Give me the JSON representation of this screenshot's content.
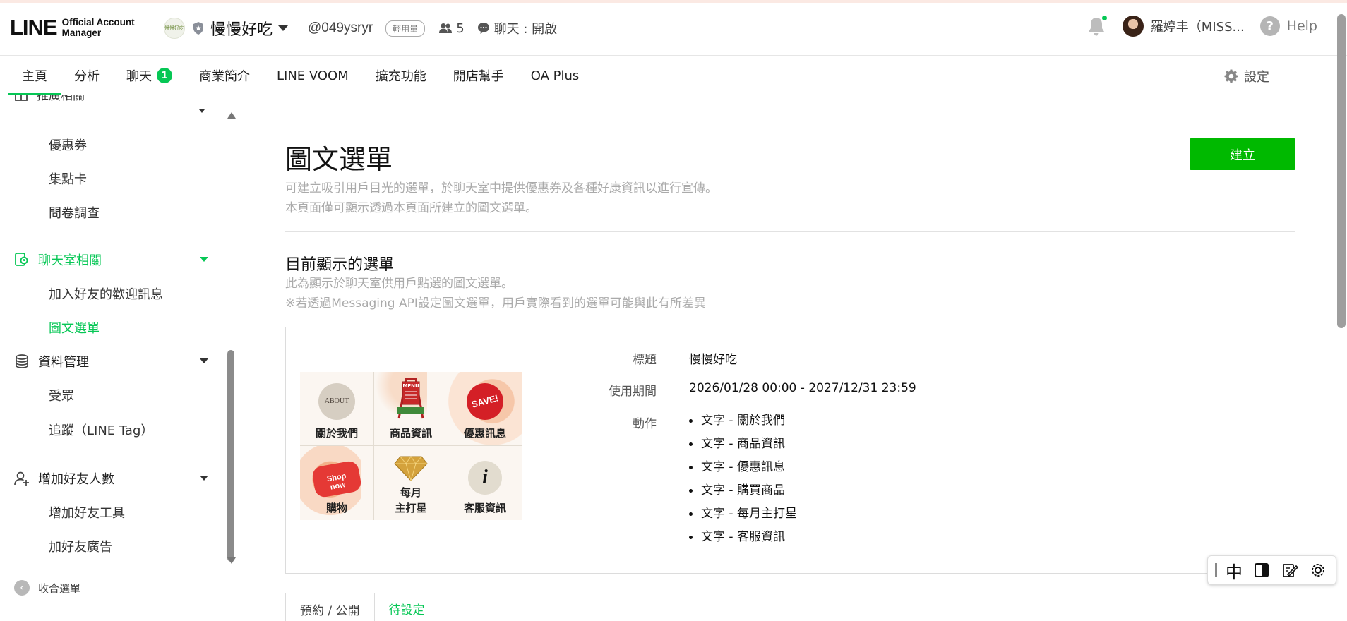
{
  "header": {
    "logo_main": "LINE",
    "logo_sub_line1": "Official Account",
    "logo_sub_line2": "Manager",
    "account_thumb": "慢慢好吃",
    "account_name": "慢慢好吃",
    "account_id": "@049ysryr",
    "plan_badge": "輕用量",
    "friend_count": "5",
    "chat_status": "聊天 : 開啟",
    "user_name": "羅婷丰（MISS...",
    "help_label": "Help"
  },
  "nav": {
    "tabs": [
      {
        "label": "主頁"
      },
      {
        "label": "分析"
      },
      {
        "label": "聊天",
        "badge": "1"
      },
      {
        "label": "商業簡介"
      },
      {
        "label": "LINE VOOM"
      },
      {
        "label": "擴充功能"
      },
      {
        "label": "開店幫手"
      },
      {
        "label": "OA Plus"
      }
    ],
    "settings_label": "設定"
  },
  "sidebar": {
    "cut_group": "推廣相關",
    "promo_items": [
      "優惠券",
      "集點卡",
      "問卷調查"
    ],
    "chat_group": "聊天室相關",
    "chat_items": [
      "加入好友的歡迎訊息",
      "圖文選單"
    ],
    "data_group": "資料管理",
    "data_items": [
      "受眾",
      "追蹤（LINE Tag）"
    ],
    "friends_group": "增加好友人數",
    "friends_items": [
      "增加好友工具",
      "加好友廣告"
    ],
    "collapse_label": "收合選單"
  },
  "main": {
    "title": "圖文選單",
    "desc_line1": "可建立吸引用戶目光的選單，於聊天室中提供優惠券及各種好康資訊以進行宣傳。",
    "desc_line2": "本頁面僅可顯示透過本頁面所建立的圖文選單。",
    "create_button": "建立",
    "section_title": "目前顯示的選單",
    "section_desc1": "此為顯示於聊天室供用戶點選的圖文選單。",
    "section_desc2": "※若透過Messaging API設定圖文選單，用戶實際看到的選單可能與此有所差異",
    "menu_cells": [
      {
        "label": "關於我們",
        "art": "ABOUT"
      },
      {
        "label": "商品資訊",
        "art": "MENU"
      },
      {
        "label": "優惠訊息",
        "art": "SAVE!"
      },
      {
        "label": "購物",
        "art": "Shop now"
      },
      {
        "label_line1": "每月",
        "label_line2": "主打星"
      },
      {
        "label": "客服資訊",
        "art": "i"
      }
    ],
    "detail": {
      "title_label": "標題",
      "title_value": "慢慢好吃",
      "period_label": "使用期間",
      "period_value": "2026/01/28 00:00 - 2027/12/31 23:59",
      "action_label": "動作",
      "actions": [
        "文字 - 關於我們",
        "文字 - 商品資訊",
        "文字 - 優惠訊息",
        "文字 - 購買商品",
        "文字 - 每月主打星",
        "文字 - 客服資訊"
      ]
    },
    "bottom_tabs": [
      "預約 / 公開",
      "待設定"
    ]
  },
  "ime": {
    "mode": "中"
  },
  "colors": {
    "brand_green": "#06c755",
    "button_green": "#00b900",
    "notification_dot": "#06c755"
  }
}
